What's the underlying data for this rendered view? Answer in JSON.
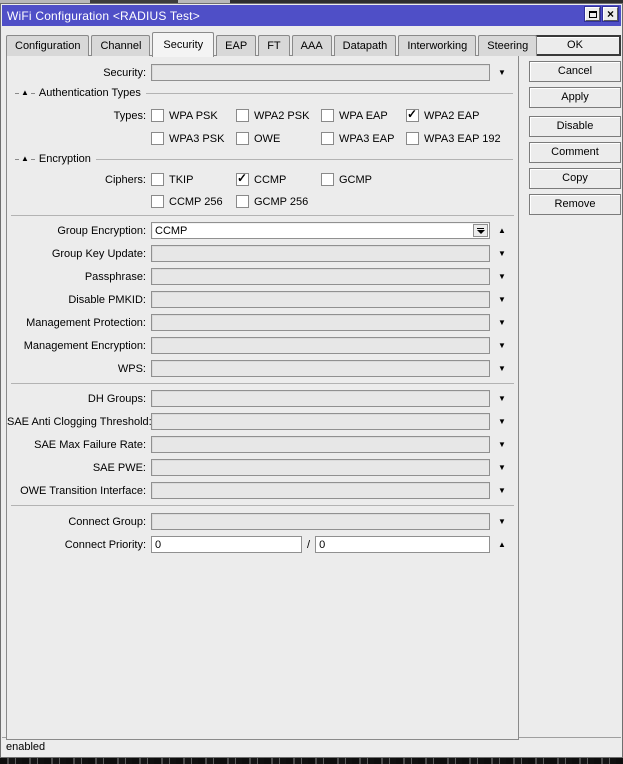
{
  "colors": {
    "titlebar": "#4f4fc7",
    "dialogbg": "#ececec"
  },
  "window": {
    "title": "WiFi Configuration <RADIUS Test>",
    "close_icon": "×"
  },
  "tabs": [
    {
      "label": "Configuration",
      "active": false
    },
    {
      "label": "Channel",
      "active": false
    },
    {
      "label": "Security",
      "active": true
    },
    {
      "label": "EAP",
      "active": false
    },
    {
      "label": "FT",
      "active": false
    },
    {
      "label": "AAA",
      "active": false
    },
    {
      "label": "Datapath",
      "active": false
    },
    {
      "label": "Interworking",
      "active": false
    },
    {
      "label": "Steering",
      "active": false
    }
  ],
  "buttons": {
    "ok": "OK",
    "cancel": "Cancel",
    "apply": "Apply",
    "disable": "Disable",
    "comment": "Comment",
    "copy": "Copy",
    "remove": "Remove"
  },
  "sections": {
    "auth_types": "Authentication Types",
    "encryption": "Encryption"
  },
  "fields": {
    "security": {
      "label": "Security:"
    },
    "types": {
      "label": "Types:",
      "rows": [
        [
          {
            "label": "WPA PSK",
            "checked": false
          },
          {
            "label": "WPA2 PSK",
            "checked": false
          },
          {
            "label": "WPA EAP",
            "checked": false
          },
          {
            "label": "WPA2 EAP",
            "checked": true
          }
        ],
        [
          {
            "label": "WPA3 PSK",
            "checked": false
          },
          {
            "label": "OWE",
            "checked": false
          },
          {
            "label": "WPA3 EAP",
            "checked": false
          },
          {
            "label": "WPA3 EAP 192",
            "checked": false
          }
        ]
      ]
    },
    "ciphers": {
      "label": "Ciphers:",
      "rows": [
        [
          {
            "label": "TKIP",
            "checked": false
          },
          {
            "label": "CCMP",
            "checked": true
          },
          {
            "label": "GCMP",
            "checked": false
          }
        ],
        [
          {
            "label": "CCMP 256",
            "checked": false
          },
          {
            "label": "GCMP 256",
            "checked": false
          }
        ]
      ]
    },
    "group_encryption": {
      "label": "Group Encryption:",
      "value": "CCMP"
    },
    "group_key_update": {
      "label": "Group Key Update:"
    },
    "passphrase": {
      "label": "Passphrase:"
    },
    "disable_pmkid": {
      "label": "Disable PMKID:"
    },
    "management_protection": {
      "label": "Management Protection:"
    },
    "management_encryption": {
      "label": "Management Encryption:"
    },
    "wps": {
      "label": "WPS:"
    },
    "dh_groups": {
      "label": "DH Groups:"
    },
    "sae_anti_clogging_threshold": {
      "label": "SAE Anti Clogging Threshold:"
    },
    "sae_max_failure_rate": {
      "label": "SAE Max Failure Rate:"
    },
    "sae_pwe": {
      "label": "SAE PWE:"
    },
    "owe_transition_interface": {
      "label": "OWE Transition Interface:"
    },
    "connect_group": {
      "label": "Connect Group:"
    },
    "connect_priority": {
      "label": "Connect Priority:",
      "value1": "0",
      "separator": "/",
      "value2": "0"
    }
  },
  "icons": {
    "down_arrow": "▼",
    "up_arrow": "▲",
    "check": "✓"
  },
  "statusbar": {
    "text": "enabled"
  }
}
